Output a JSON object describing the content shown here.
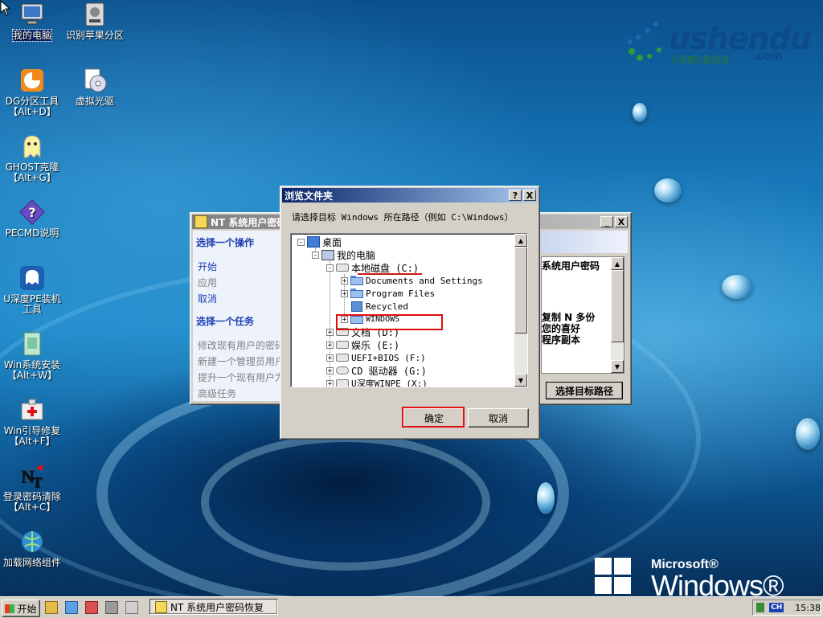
{
  "desktop": {
    "icons": [
      {
        "label": "我的电脑",
        "icon": "computer-icon"
      },
      {
        "label": "识别苹果分区",
        "icon": "disk-tool-icon"
      },
      {
        "label": "DG分区工具\n【Alt+D】",
        "icon": "dg-partition-icon"
      },
      {
        "label": "虚拟光驱",
        "icon": "virtual-cd-icon"
      },
      {
        "label": "GHOST克隆\n【Alt+G】",
        "icon": "ghost-icon"
      },
      {
        "label": "PECMD说明",
        "icon": "help-icon"
      },
      {
        "label": "U深度PE装机\n工具",
        "icon": "pe-installer-icon"
      },
      {
        "label": "Win系统安装\n【Alt+W】",
        "icon": "win-install-icon"
      },
      {
        "label": "Win引导修复\n【Alt+F】",
        "icon": "boot-repair-icon"
      },
      {
        "label": "登录密码清除\n【Alt+C】",
        "icon": "password-clear-icon"
      },
      {
        "label": "加载网络组件",
        "icon": "network-icon"
      }
    ],
    "brand": {
      "name": "ushendu",
      "tagline": "U深度U盘启动",
      "suffix": ".com"
    },
    "winpe": {
      "microsoft": "Microsoft®",
      "product": "Windows® PE"
    }
  },
  "nt_window": {
    "title": "NT 系统用户密码",
    "minimize": "_",
    "close": "X",
    "left_panel": {
      "heading1": "选择一个操作",
      "actions": [
        "开始",
        "应用",
        "取消"
      ],
      "heading2": "选择一个任务",
      "tasks": [
        "修改现有用户的密码",
        "新建一个管理员用户",
        "提升一个现有用户为",
        "高级任务"
      ]
    },
    "right_panel": {
      "line1": "系统用户密码",
      "line2": "复制 N 多份",
      "line3": "您的喜好",
      "line4": "程序副本",
      "button": "选择目标路径"
    }
  },
  "browse_dialog": {
    "title": "浏览文件夹",
    "help": "?",
    "close": "X",
    "prompt": "请选择目标 Windows 所在路径（例如 C:\\Windows）",
    "tree": [
      {
        "label": "桌面",
        "toggle": "-",
        "icon": "desktop-icon"
      },
      {
        "label": "我的电脑",
        "toggle": "-",
        "icon": "computer-icon"
      },
      {
        "label": "本地磁盘 (C:)",
        "toggle": "-",
        "icon": "drive-icon"
      },
      {
        "label": "Documents and Settings",
        "toggle": "+",
        "icon": "folder-icon"
      },
      {
        "label": "Program Files",
        "toggle": "+",
        "icon": "folder-icon"
      },
      {
        "label": "Recycled",
        "toggle": "",
        "icon": "recycle-icon"
      },
      {
        "label": "WINDOWS",
        "toggle": "+",
        "icon": "folder-icon"
      },
      {
        "label": "文档 (D:)",
        "toggle": "+",
        "icon": "drive-icon"
      },
      {
        "label": "娱乐 (E:)",
        "toggle": "+",
        "icon": "drive-icon"
      },
      {
        "label": "UEFI+BIOS (F:)",
        "toggle": "+",
        "icon": "drive-icon"
      },
      {
        "label": "CD 驱动器 (G:)",
        "toggle": "+",
        "icon": "cd-drive-icon"
      },
      {
        "label": "U深度WINPE (X:)",
        "toggle": "+",
        "icon": "drive-icon"
      }
    ],
    "ok": "确定",
    "cancel": "取消"
  },
  "taskbar": {
    "start": "开始",
    "task_button": "NT 系统用户密码恢复",
    "lang": "CH",
    "clock": "15:38"
  }
}
